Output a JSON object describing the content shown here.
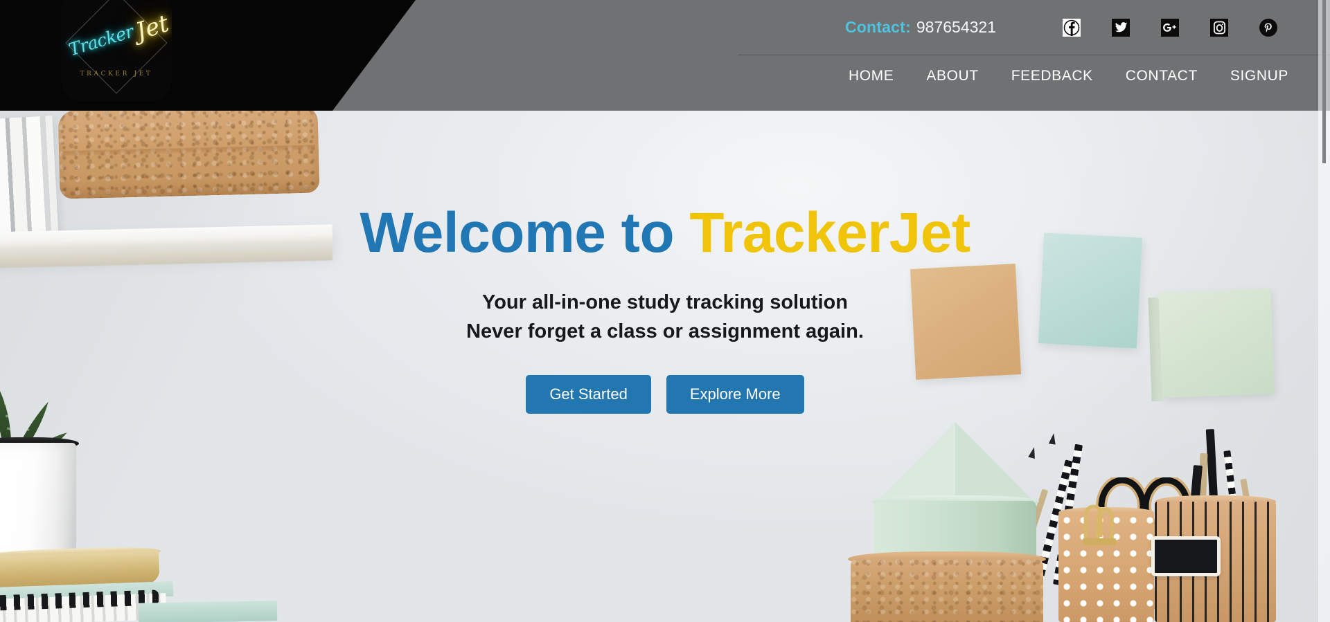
{
  "site": {
    "name": "TrackerJet",
    "logo": {
      "script_primary": "Tracker",
      "script_secondary": "Jet",
      "subtitle": "TRACKER JET",
      "neon_cyan": "#2ad4e0",
      "neon_gold": "#ffd628"
    }
  },
  "topbar": {
    "contact_label": "Contact:",
    "contact_number": "987654321",
    "contact_label_color": "#4ec3e0",
    "socials": [
      {
        "name": "facebook-icon",
        "glyph": "f",
        "style": "square-white"
      },
      {
        "name": "twitter-icon",
        "glyph": "bird",
        "style": "square-black"
      },
      {
        "name": "google-plus-icon",
        "glyph": "G+",
        "style": "square-black"
      },
      {
        "name": "instagram-icon",
        "glyph": "camera",
        "style": "square-black"
      },
      {
        "name": "pinterest-icon",
        "glyph": "P",
        "style": "circle-black"
      }
    ]
  },
  "nav": {
    "items": [
      {
        "id": "home",
        "label": "HOME"
      },
      {
        "id": "about",
        "label": "ABOUT"
      },
      {
        "id": "feedback",
        "label": "FEEDBACK"
      },
      {
        "id": "contact",
        "label": "CONTACT"
      },
      {
        "id": "signup",
        "label": "SIGNUP"
      }
    ]
  },
  "hero": {
    "title_part1": "Welcome to ",
    "title_part2": "TrackerJet",
    "title_color_1": "#2077b4",
    "title_color_2": "#f0c408",
    "subtitle_line1": "Your all-in-one study tracking solution",
    "subtitle_line2": "Never forget a class or assignment again.",
    "buttons": [
      {
        "id": "get-started",
        "label": "Get Started"
      },
      {
        "id": "explore-more",
        "label": "Explore More"
      }
    ],
    "button_color": "#2277b0"
  },
  "theme": {
    "header_gray": "#6f7173",
    "header_black": "#050505",
    "page_background": "#e8ebee"
  },
  "scrollbar": {
    "position": "right",
    "thumb_color": "#7e8184"
  }
}
